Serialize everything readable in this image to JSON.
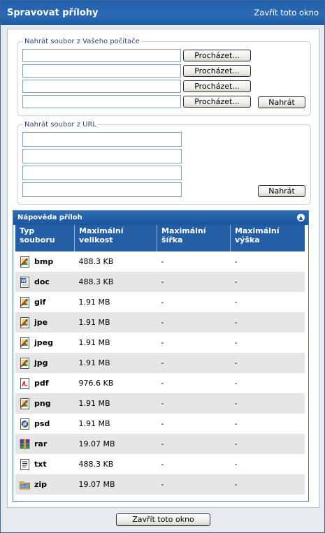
{
  "window": {
    "title": "Spravovat přílohy",
    "close_link": "Zavřít toto okno"
  },
  "upload_local": {
    "legend": "Nahrát soubor z Vašeho počítače",
    "inputs": [
      "",
      "",
      "",
      ""
    ],
    "browse_label": "Procházet...",
    "upload_button": "Nahrát"
  },
  "upload_url": {
    "legend": "Nahrát soubor z URL",
    "inputs": [
      "",
      "",
      "",
      ""
    ],
    "upload_button": "Nahrát"
  },
  "help": {
    "title": "Nápověda příloh",
    "headers": [
      "Typ souboru",
      "Maximální velikost",
      "Maximální šířka",
      "Maximální výška"
    ],
    "rows": [
      {
        "icon": "image-file-icon",
        "type": "bmp",
        "size": "488.3 KB",
        "width": "-",
        "height": "-"
      },
      {
        "icon": "word-document-icon",
        "type": "doc",
        "size": "488.3 KB",
        "width": "-",
        "height": "-"
      },
      {
        "icon": "image-file-icon",
        "type": "gif",
        "size": "1.91 MB",
        "width": "-",
        "height": "-"
      },
      {
        "icon": "image-file-icon",
        "type": "jpe",
        "size": "1.91 MB",
        "width": "-",
        "height": "-"
      },
      {
        "icon": "image-file-icon",
        "type": "jpeg",
        "size": "1.91 MB",
        "width": "-",
        "height": "-"
      },
      {
        "icon": "image-file-icon",
        "type": "jpg",
        "size": "1.91 MB",
        "width": "-",
        "height": "-"
      },
      {
        "icon": "pdf-file-icon",
        "type": "pdf",
        "size": "976.6 KB",
        "width": "-",
        "height": "-"
      },
      {
        "icon": "image-file-icon",
        "type": "png",
        "size": "1.91 MB",
        "width": "-",
        "height": "-"
      },
      {
        "icon": "photoshop-file-icon",
        "type": "psd",
        "size": "1.91 MB",
        "width": "-",
        "height": "-"
      },
      {
        "icon": "archive-rar-icon",
        "type": "rar",
        "size": "19.07 MB",
        "width": "-",
        "height": "-"
      },
      {
        "icon": "text-file-icon",
        "type": "txt",
        "size": "488.3 KB",
        "width": "-",
        "height": "-"
      },
      {
        "icon": "zip-folder-icon",
        "type": "zip",
        "size": "19.07 MB",
        "width": "-",
        "height": "-"
      }
    ]
  },
  "footer": {
    "close_button": "Zavřít toto okno"
  }
}
